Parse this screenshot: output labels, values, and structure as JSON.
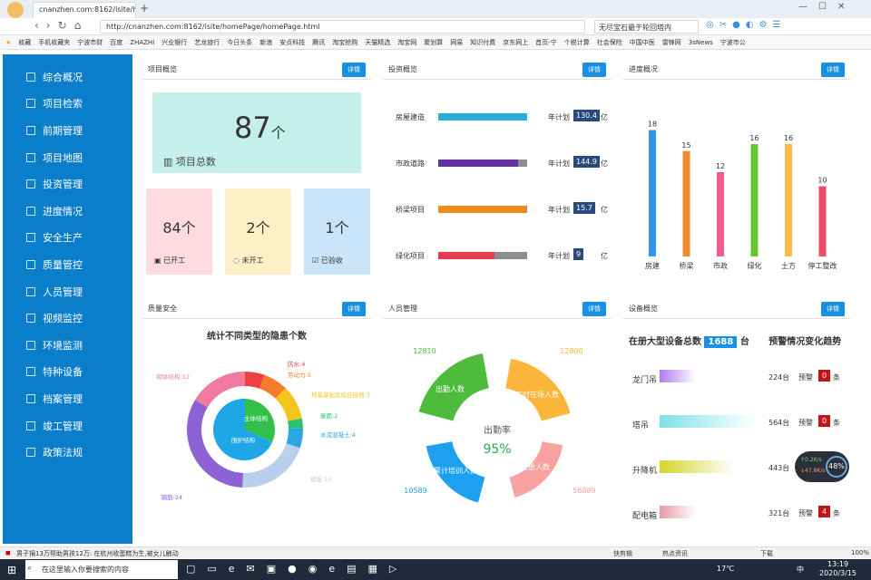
{
  "browser": {
    "tab_title": "cnanzhen.com:8162/isite/hom",
    "url": "http://cnanzhen.com:8162/isite/homePage/homePage.html",
    "search_text": "无尽宝石最于轮回塔内",
    "bookmarks": [
      "收藏",
      "手机收藏夹",
      "宁波市财",
      "百度",
      "ZHAZHI",
      "兴业银行",
      "艺龙旅行",
      "今日头条",
      "新浪",
      "安贞科技",
      "腾讯",
      "淘宝抢购",
      "天猫精选",
      "淘宝网",
      "聚划算",
      "网易",
      "知识付费",
      "京东网上",
      "首页-宁",
      "个税计算",
      "社会保险",
      "中国中医",
      "雷锋网",
      "3sNews",
      "宁波市公"
    ]
  },
  "sidebar": {
    "items": [
      "综合概况",
      "项目检索",
      "前期管理",
      "项目地图",
      "投资管理",
      "进度情况",
      "安全生产",
      "质量管控",
      "人员管理",
      "视频监控",
      "环境监测",
      "特种设备",
      "档案管理",
      "竣工管理",
      "政策法规"
    ]
  },
  "detail_label": "详情",
  "project": {
    "title": "项目概览",
    "total_value": "87",
    "total_unit": "个",
    "total_label": "项目总数",
    "cards": [
      {
        "value": "84",
        "unit": "个",
        "label": "已开工",
        "bg": "#fddbe0"
      },
      {
        "value": "2",
        "unit": "个",
        "label": "未开工",
        "bg": "#fff0c8"
      },
      {
        "value": "1",
        "unit": "个",
        "label": "已验收",
        "bg": "#c9e4f8"
      }
    ]
  },
  "investment": {
    "title": "投资概览",
    "plan_label": "年计划",
    "currency": "亿",
    "rows": [
      {
        "name": "房屋建造",
        "plan": "130.4",
        "fill": 1.0,
        "color": "#28afd7"
      },
      {
        "name": "市政道路",
        "plan": "144.9",
        "fill": 0.9,
        "color": "#6534a0"
      },
      {
        "name": "桥梁项目",
        "plan": "15.7",
        "fill": 0.99,
        "color": "#f08c1c"
      },
      {
        "name": "绿化项目",
        "plan": "9",
        "fill": 0.63,
        "color": "#e33c4e"
      }
    ]
  },
  "progress": {
    "title": "进度概况",
    "chart_data": {
      "type": "bar",
      "categories": [
        "房建",
        "桥梁",
        "市政",
        "绿化",
        "土方",
        "停工整改"
      ],
      "values": [
        18,
        15,
        12,
        16,
        16,
        10
      ],
      "colors": [
        "#3296f0",
        "#f08c2e",
        "#ef5f8e",
        "#66c62d",
        "#fbb94a",
        "#f04a6a"
      ],
      "ylim": [
        0,
        20
      ]
    }
  },
  "quality": {
    "title": "质量安全",
    "chart_title": "统计不同类型的隐患个数",
    "center_labels": [
      "主体结构",
      "围护结构"
    ],
    "chart_data": {
      "type": "pie",
      "categories": [
        "防水",
        "劳动力",
        "地基基础及综合接地",
        "屋面",
        "水泥混凝土",
        "模板",
        "钢筋",
        "砌体结构"
      ],
      "values": [
        4,
        5,
        7,
        2,
        4,
        15,
        24,
        12
      ],
      "labels": [
        "防水:4",
        "劳动力:5",
        "地基基础及综合接地:7",
        "屋面:2",
        "水泥混凝土:4",
        "模板:15",
        "钢筋:24",
        "砌体结构:12"
      ],
      "colors": [
        "#ef4044",
        "#f57c2a",
        "#f4c51c",
        "#26c46f",
        "#2aa6e6",
        "#b9cfec",
        "#8c62d4",
        "#f07aa0"
      ]
    }
  },
  "personnel": {
    "title": "人员管理",
    "center_title": "出勤率",
    "center_value": "95%",
    "segments": [
      {
        "label": "出勤人数",
        "value": "12810",
        "color": "#4fbb3c"
      },
      {
        "label": "实时在场人数",
        "value": "12800",
        "color": "#fbb53a"
      },
      {
        "label": "在册人数",
        "value": "56889",
        "color": "#f9a1a1"
      },
      {
        "label": "累计培训人数",
        "value": "10589",
        "color": "#1da0f0"
      }
    ]
  },
  "equipment": {
    "title": "设备概览",
    "total_label": "在册大型设备总数",
    "total_value": "1688",
    "total_unit": "台",
    "trend_label": "预警情况变化趋势",
    "warn_label": "预警",
    "warn_unit": "条",
    "rows": [
      {
        "name": "龙门吊",
        "count": "224台",
        "warn": "0",
        "color": "#b07af0"
      },
      {
        "name": "塔吊",
        "count": "564台",
        "warn": "0",
        "color": "#7fe0e8"
      },
      {
        "name": "升降机",
        "count": "443台",
        "warn": "",
        "color": "#d4d62a"
      },
      {
        "name": "配电箱",
        "count": "321台",
        "warn": "4",
        "color": "#e89aa8"
      }
    ]
  },
  "net_widget": {
    "up": "0.2",
    "up_unit": "K/s",
    "down": "47.8",
    "down_unit": "K/s",
    "percent": "48%"
  },
  "statusbar": {
    "news": "男子捐13万帮助男孩12万: 在杭州收蛋糕为生,被女儿触动",
    "items": [
      "快剪辑",
      "热点资讯",
      "下载",
      "100%"
    ]
  },
  "taskbar": {
    "search_placeholder": "在这里输入你要搜索的内容",
    "temp": "17℃",
    "ime": "中",
    "time": "13:19",
    "date": "2020/3/15"
  }
}
